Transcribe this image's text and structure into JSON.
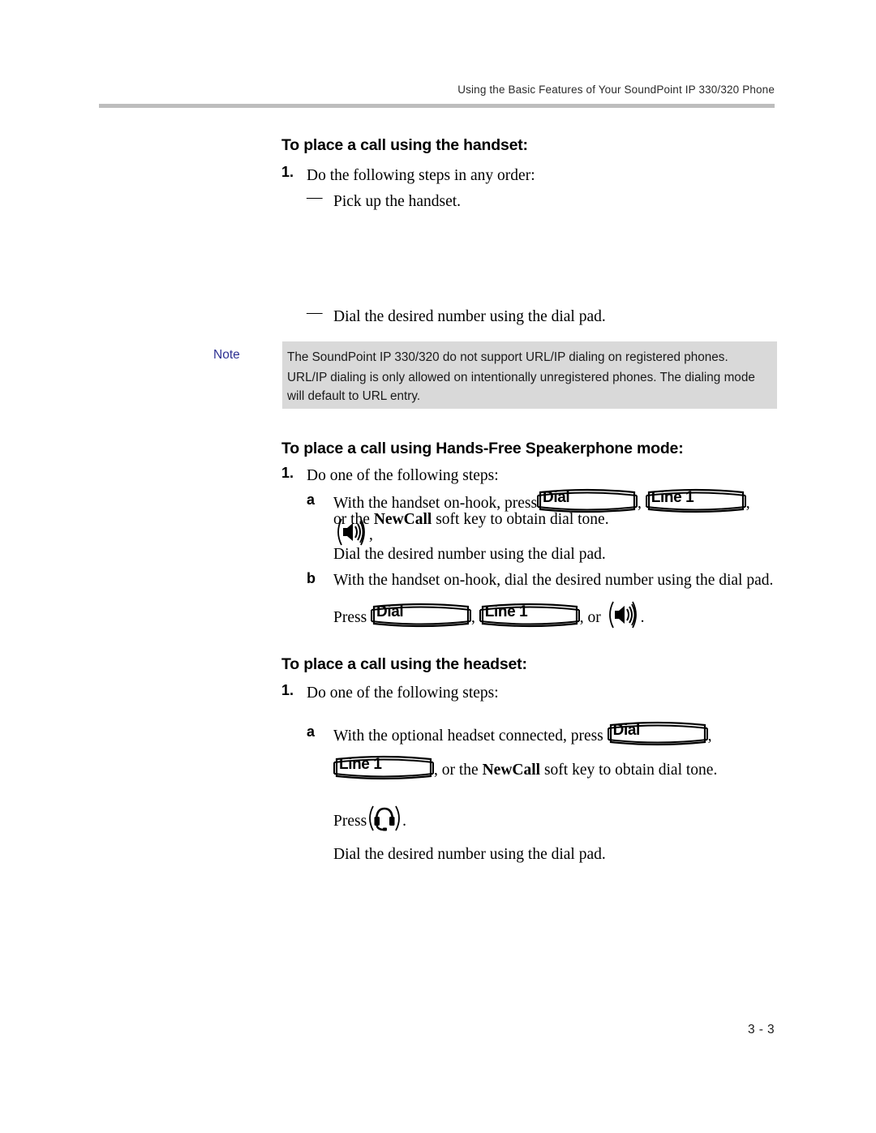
{
  "header": {
    "running_head": "Using the Basic Features of Your SoundPoint IP 330/320 Phone"
  },
  "footer": {
    "page_number": "3 - 3"
  },
  "colors": {
    "note_label": "#2e3192",
    "note_background": "#d9d9d9",
    "header_rule": "#bdbdbd"
  },
  "sections": {
    "handset": {
      "heading": "To place a call using the handset:",
      "step_number": "1.",
      "step_text": "Do the following steps in any order:",
      "bullets": [
        {
          "marker": "—",
          "text": "Pick up the handset."
        },
        {
          "marker": "—",
          "text": "Dial the desired number using the dial pad."
        }
      ]
    },
    "note": {
      "label": "Note",
      "paragraph_1": "The SoundPoint IP 330/320 do not support URL/IP dialing on registered phones.",
      "paragraph_2": "URL/IP dialing is only allowed on intentionally unregistered phones. The dialing mode will default to URL entry."
    },
    "speakerphone": {
      "heading": "To place a call using Hands-Free Speakerphone mode:",
      "step_number": "1.",
      "step_text": "Do one of the following steps:",
      "item_a": {
        "marker": "a",
        "text_before_keys": "With the handset on-hook, press",
        "key_1": "Dial",
        "separator_1": ",",
        "key_2": "Line 1",
        "separator_2": ",",
        "speaker_icon": "speaker-icon",
        "trailing": ",",
        "line_2_before_bold": "or the ",
        "line_2_bold": "NewCall",
        "line_2_after_bold": " soft key to obtain dial tone.",
        "line_3": "Dial the desired number using the dial pad."
      },
      "item_b": {
        "marker": "b",
        "text": "With the handset on-hook, dial the desired number using the dial pad.",
        "press_label": "Press",
        "key_1": "Dial",
        "separator_1": ",",
        "key_2": "Line 1",
        "separator_2": ", or",
        "speaker_icon": "speaker-icon",
        "trailing": "."
      }
    },
    "headset": {
      "heading": "To place a call using the headset:",
      "step_number": "1.",
      "step_text": "Do one of the following steps:",
      "item_a": {
        "marker": "a",
        "text_before_key": "With the optional headset connected, press",
        "key_1": "Dial",
        "separator_1": ",",
        "key_2": "Line 1",
        "line_2_before_bold": ", or the ",
        "line_2_bold": "NewCall",
        "line_2_after_bold": " soft key to obtain dial tone.",
        "press_label": "Press",
        "headset_icon": "headset-icon",
        "press_trailing": ".",
        "final_line": "Dial the desired number using the dial pad."
      }
    }
  }
}
